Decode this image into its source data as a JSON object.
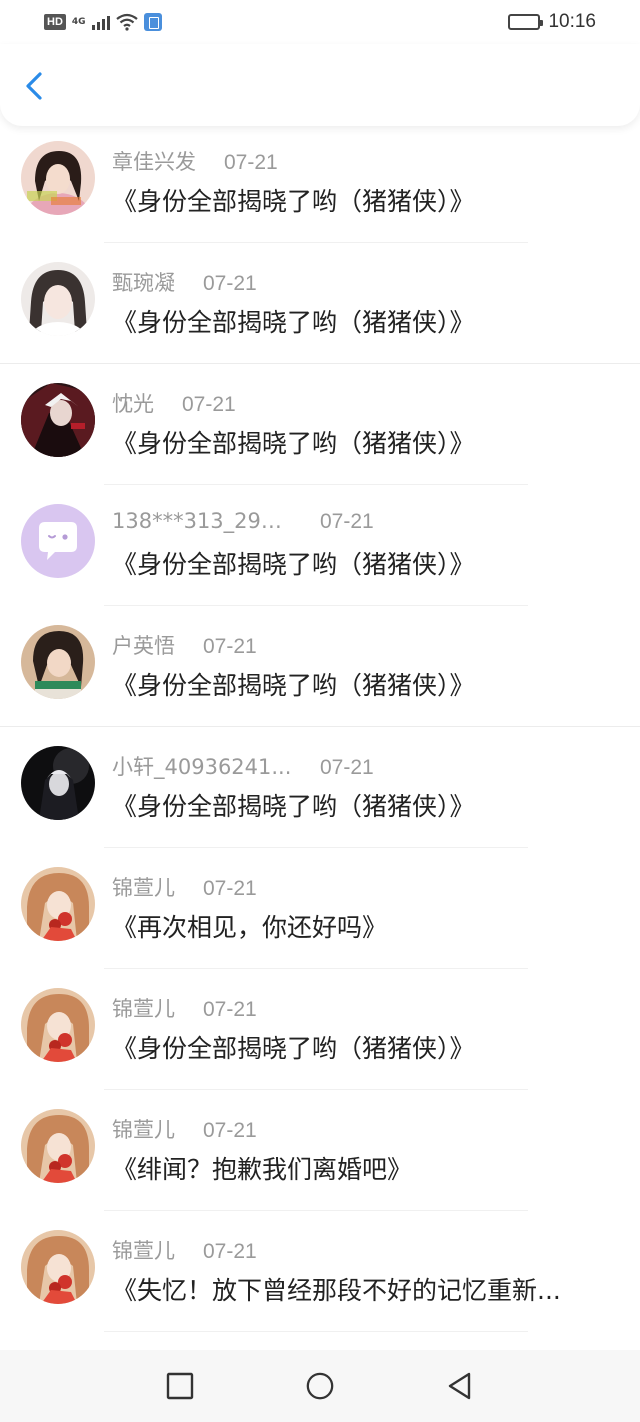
{
  "status_bar": {
    "network_badge": "HD",
    "network_type": "4G",
    "time": "10:16"
  },
  "colors": {
    "back_arrow": "#2a8be8",
    "meta_text": "#9a9a9a",
    "title_text": "#222222"
  },
  "top_nav": {
    "back_icon": "chevron-left-icon"
  },
  "list": [
    {
      "name": "章佳兴发",
      "date": "07-21",
      "title": "《身份全部揭晓了哟（猪猪侠）》",
      "avatar": "avatar-girl-pink"
    },
    {
      "name": "甄琬凝",
      "date": "07-21",
      "title": "《身份全部揭晓了哟（猪猪侠）》",
      "avatar": "avatar-girl-white"
    },
    {
      "name": "忱光",
      "date": "07-21",
      "title": "《身份全部揭晓了哟（猪猪侠）》",
      "avatar": "avatar-anime-dark"
    },
    {
      "name": "138***313_290...",
      "date": "07-21",
      "title": "《身份全部揭晓了哟（猪猪侠）》",
      "avatar": "avatar-default-chat"
    },
    {
      "name": "户英悟",
      "date": "07-21",
      "title": "《身份全部揭晓了哟（猪猪侠）》",
      "avatar": "avatar-girl-scarf"
    },
    {
      "name": "小轩_40936241...",
      "date": "07-21",
      "title": "《身份全部揭晓了哟（猪猪侠）》",
      "avatar": "avatar-boy-dark"
    },
    {
      "name": "锦萱儿",
      "date": "07-21",
      "title": "《再次相见，你还好吗》",
      "avatar": "avatar-girl-flower"
    },
    {
      "name": "锦萱儿",
      "date": "07-21",
      "title": "《身份全部揭晓了哟（猪猪侠）》",
      "avatar": "avatar-girl-flower"
    },
    {
      "name": "锦萱儿",
      "date": "07-21",
      "title": "《绯闻？抱歉我们离婚吧》",
      "avatar": "avatar-girl-flower"
    },
    {
      "name": "锦萱儿",
      "date": "07-21",
      "title": "《失忆！放下曾经那段不好的记忆重新...",
      "avatar": "avatar-girl-flower"
    }
  ],
  "nav_bar": {
    "recent_icon": "square-icon",
    "home_icon": "circle-icon",
    "back_icon": "triangle-back-icon"
  }
}
